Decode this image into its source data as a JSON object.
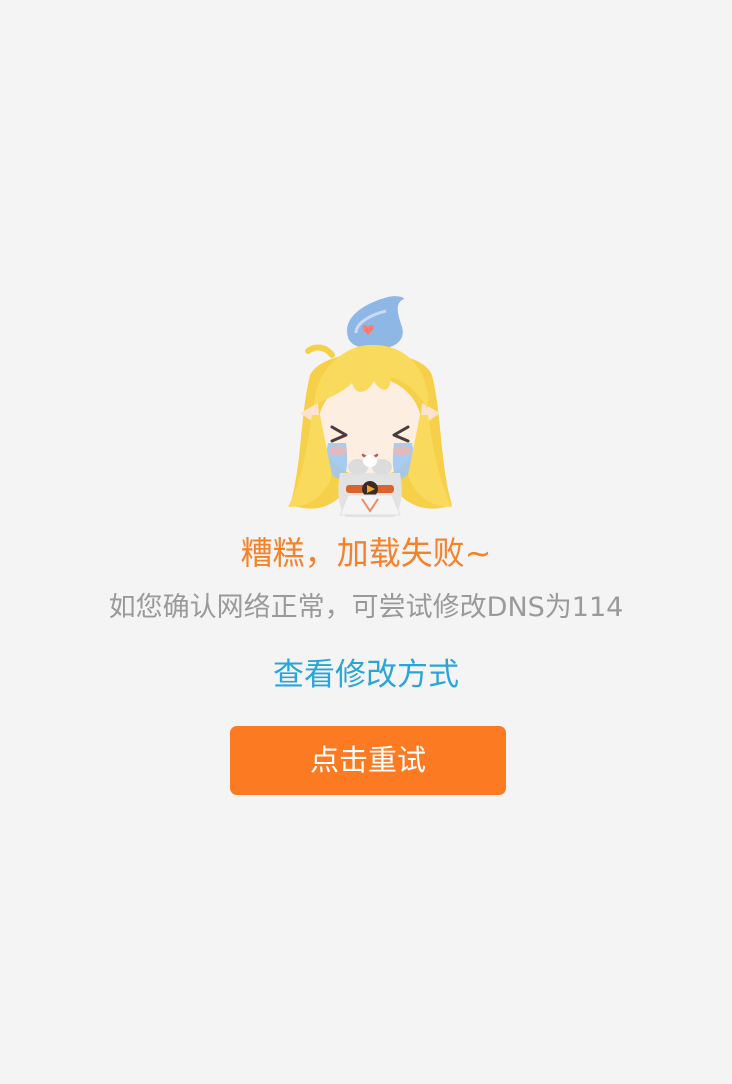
{
  "error": {
    "title": "糟糕，加载失败~",
    "description": "如您确认网络正常，可尝试修改DNS为114",
    "help_link": "查看修改方式",
    "retry_button": "点击重试"
  },
  "mascot": {
    "name": "crying-mascot",
    "state": "crying",
    "colors": {
      "hair": "#f7d04a",
      "hat": "#8fb7e6",
      "heart": "#ff7b6e",
      "tears": "#9ec7f2"
    }
  },
  "colors": {
    "background": "#f4f4f4",
    "title": "#f5822a",
    "description": "#9a9a9a",
    "link": "#2aa5d8",
    "button": "#fb7a22",
    "button_text": "#ffffff"
  }
}
